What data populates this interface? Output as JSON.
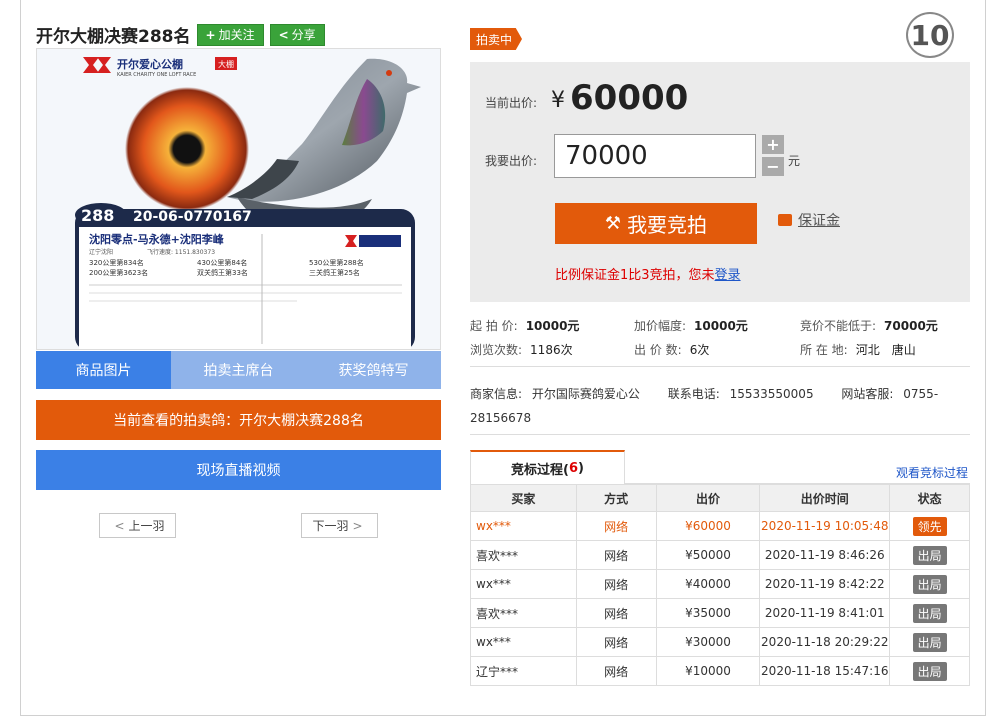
{
  "lot": {
    "title": "开尔大棚决赛288名",
    "follow_label": "加关注",
    "share_label": "分享",
    "number": "10",
    "status": "拍卖中"
  },
  "photo": {
    "brand_line": "开尔爱心公棚",
    "brand_tag": "大棚",
    "brand_sub": "KAIER CHARITY ONE LOFT RACE",
    "rank_badge": "288",
    "ring_number": "20-06-0770167",
    "owner_line": "沈阳零点-马永德+沈阳李峰",
    "region": "辽宁沈阳",
    "speed": "飞行速度: 1151.830373",
    "results": [
      "320公里第834名",
      "430公里第84名",
      "530公里第288名",
      "200公里第3623名",
      "双关鸽王第33名",
      "三关鸽王第25名"
    ]
  },
  "tabs": [
    {
      "label": "商品图片",
      "active": true
    },
    {
      "label": "拍卖主席台",
      "active": false
    },
    {
      "label": "获奖鸽特写",
      "active": false
    }
  ],
  "current_view_banner": "当前查看的拍卖鸽：开尔大棚决赛288名",
  "live_video_label": "现场直播视频",
  "prev_label": "上一羽",
  "next_label": "下一羽",
  "bid": {
    "current_label": "当前出价:",
    "currency": "¥",
    "current_price": "60000",
    "my_label": "我要出价:",
    "my_value": "70000",
    "plus": "+",
    "minus": "−",
    "unit": "元",
    "button_label": "我要竞拍",
    "deposit_label": "保证金",
    "note_text": "比例保证金1比3竞拍，您未",
    "note_link": "登录"
  },
  "info": {
    "start_price_label": "起 拍 价:",
    "start_price": "10000元",
    "increment_label": "加价幅度:",
    "increment": "10000元",
    "reserve_label": "竞价不能低于:",
    "reserve": "70000元",
    "views_label": "浏览次数:",
    "views": "1186次",
    "bids_label": "出 价 数:",
    "bids": "6次",
    "location_label": "所 在 地:",
    "location": "河北　唐山"
  },
  "seller": {
    "merchant_label": "商家信息:",
    "merchant": "开尔国际赛鸽爱心公",
    "phone_label": "联系电话:",
    "phone": "15533550005",
    "service_label": "网站客服:",
    "service_1": "0755-",
    "service_2": "28156678"
  },
  "history": {
    "tab_label": "竞标过程(",
    "count": "6",
    "tab_close": ")",
    "view_link": "观看竞标过程",
    "headers": [
      "买家",
      "方式",
      "出价",
      "出价时间",
      "状态"
    ],
    "rows": [
      {
        "buyer": "wx***",
        "method": "网络",
        "price": "¥60000",
        "time": "2020-11-19 10:05:48",
        "status": "领先",
        "lead": true
      },
      {
        "buyer": "喜欢***",
        "method": "网络",
        "price": "¥50000",
        "time": "2020-11-19 8:46:26",
        "status": "出局",
        "lead": false
      },
      {
        "buyer": "wx***",
        "method": "网络",
        "price": "¥40000",
        "time": "2020-11-19 8:42:22",
        "status": "出局",
        "lead": false
      },
      {
        "buyer": "喜欢***",
        "method": "网络",
        "price": "¥35000",
        "time": "2020-11-19 8:41:01",
        "status": "出局",
        "lead": false
      },
      {
        "buyer": "wx***",
        "method": "网络",
        "price": "¥30000",
        "time": "2020-11-18 20:29:22",
        "status": "出局",
        "lead": false
      },
      {
        "buyer": "辽宁***",
        "method": "网络",
        "price": "¥10000",
        "time": "2020-11-18 15:47:16",
        "status": "出局",
        "lead": false
      }
    ]
  },
  "colors": {
    "accent_orange": "#e25a0b",
    "accent_blue": "#3b80e6",
    "follow_green": "#3aa33a"
  }
}
